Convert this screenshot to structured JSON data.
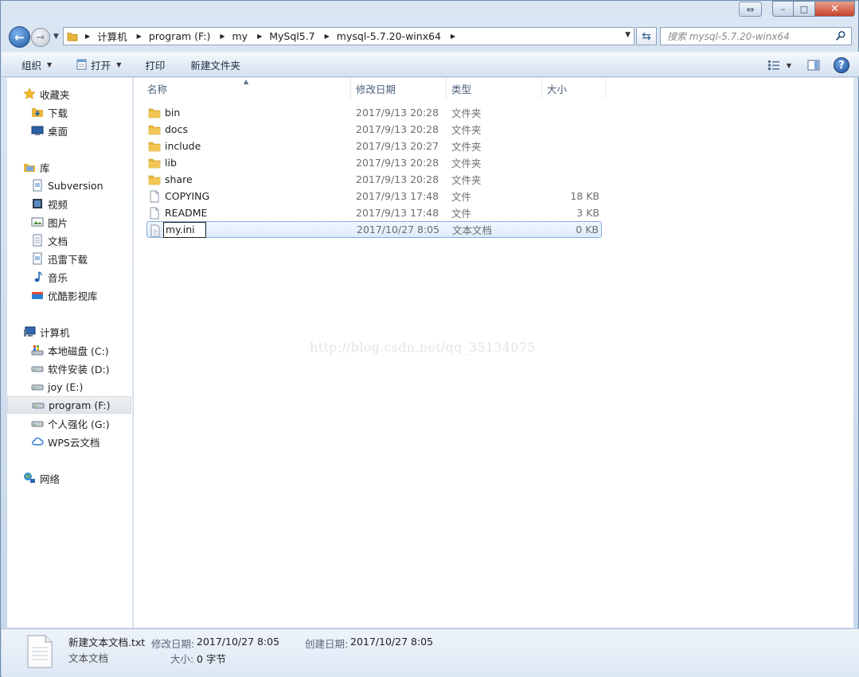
{
  "window": {
    "caption_buttons": {
      "restore_left": "⇔",
      "minimize": "–",
      "maximize": "□",
      "close": "✕"
    }
  },
  "address": {
    "crumbs": [
      "计算机",
      "program (F:)",
      "my",
      "MySql5.7",
      "mysql-5.7.20-winx64"
    ]
  },
  "search": {
    "placeholder": "搜索 mysql-5.7.20-winx64"
  },
  "toolbar": {
    "organize": "组织",
    "open": "打开",
    "print": "打印",
    "new_folder": "新建文件夹"
  },
  "nav": {
    "favorites": {
      "label": "收藏夹",
      "items": [
        "下载",
        "桌面"
      ]
    },
    "libraries": {
      "label": "库",
      "items": [
        "Subversion",
        "视频",
        "图片",
        "文档",
        "迅雷下载",
        "音乐",
        "优酷影视库"
      ]
    },
    "computer": {
      "label": "计算机",
      "items": [
        "本地磁盘 (C:)",
        "软件安装 (D:)",
        "joy (E:)",
        "program (F:)",
        "个人强化 (G:)",
        "WPS云文档"
      ]
    },
    "network": {
      "label": "网络"
    }
  },
  "columns": {
    "name": "名称",
    "date": "修改日期",
    "type": "类型",
    "size": "大小"
  },
  "files": [
    {
      "name": "bin",
      "date": "2017/9/13 20:28",
      "type": "文件夹",
      "size": "",
      "icon": "folder-icon"
    },
    {
      "name": "docs",
      "date": "2017/9/13 20:28",
      "type": "文件夹",
      "size": "",
      "icon": "folder-icon"
    },
    {
      "name": "include",
      "date": "2017/9/13 20:27",
      "type": "文件夹",
      "size": "",
      "icon": "folder-icon"
    },
    {
      "name": "lib",
      "date": "2017/9/13 20:28",
      "type": "文件夹",
      "size": "",
      "icon": "folder-icon"
    },
    {
      "name": "share",
      "date": "2017/9/13 20:28",
      "type": "文件夹",
      "size": "",
      "icon": "folder-icon"
    },
    {
      "name": "COPYING",
      "date": "2017/9/13 17:48",
      "type": "文件",
      "size": "18 KB",
      "icon": "file-icon"
    },
    {
      "name": "README",
      "date": "2017/9/13 17:48",
      "type": "文件",
      "size": "3 KB",
      "icon": "file-icon"
    },
    {
      "name": "my.ini",
      "date": "2017/10/27 8:05",
      "type": "文本文档",
      "size": "0 KB",
      "icon": "text-file-icon",
      "renaming": true
    }
  ],
  "watermark": "http://blog.csdn.net/qq_35134075",
  "details": {
    "file_name": "新建文本文档.txt",
    "file_type": "文本文档",
    "modified_label": "修改日期:",
    "modified_value": "2017/10/27 8:05",
    "created_label": "创建日期:",
    "created_value": "2017/10/27 8:05",
    "size_label": "大小:",
    "size_value": "0 字节"
  },
  "colors": {
    "selection_border": "#84acdd",
    "selection_fill": "#dcebfc",
    "folder": "#e8b53a"
  }
}
